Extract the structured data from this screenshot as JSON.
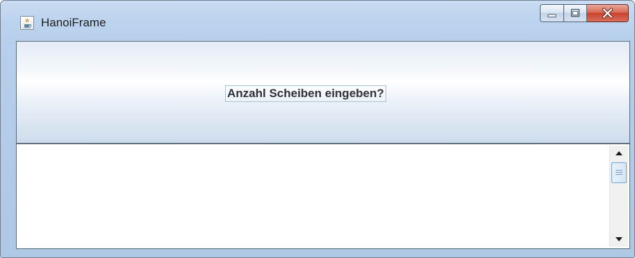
{
  "window": {
    "title": "HanoiFrame",
    "icon": "java-cup-icon",
    "controls": [
      "minimize-icon",
      "maximize-icon",
      "close-icon"
    ],
    "accent_colors": {
      "frame": "#b7cfea",
      "close_button": "#c7412a"
    }
  },
  "header": {
    "prompt": "Anzahl Scheiben eingeben?"
  },
  "output": {
    "text": ""
  },
  "scrollbar": {
    "up_icon": "arrow-up-icon",
    "down_icon": "arrow-down-icon"
  }
}
